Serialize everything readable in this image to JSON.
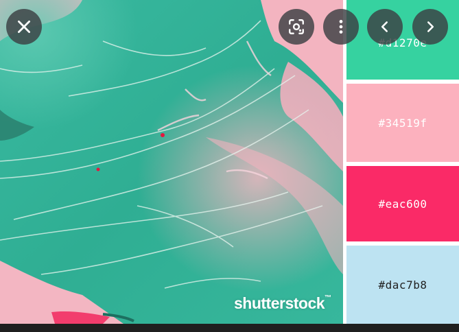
{
  "viewer": {
    "watermark": "shutterstock",
    "watermark_trademark": "™",
    "controls": {
      "close_icon": "close-icon",
      "lens_icon": "visual-search-icon",
      "more_icon": "more-vert-icon",
      "prev_icon": "chevron-left-icon",
      "next_icon": "chevron-right-icon"
    }
  },
  "palette": {
    "swatches": [
      {
        "label": "#d1270e",
        "color": "#36d2a0"
      },
      {
        "label": "#34519f",
        "color": "#fcb1be"
      },
      {
        "label": "#eac600",
        "color": "#fa2a67"
      },
      {
        "label": "#dac7b8",
        "color": "#bde3f2"
      }
    ]
  }
}
